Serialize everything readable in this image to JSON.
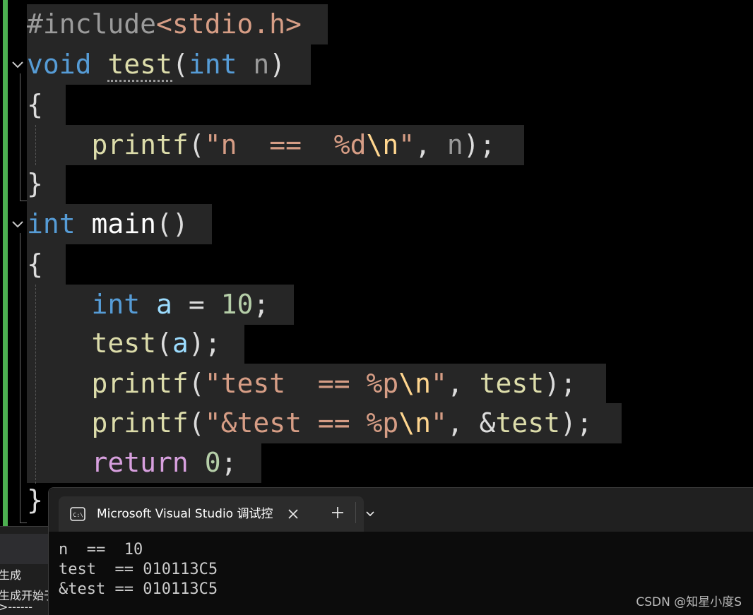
{
  "editor": {
    "lines": [
      {
        "segments": [
          [
            "#include",
            "t-pre"
          ],
          [
            "<stdio.h>",
            "t-str"
          ]
        ]
      },
      {
        "segments": [
          [
            "void",
            "t-kw"
          ],
          [
            " ",
            "t-punct"
          ],
          [
            "test",
            "t-fn squiggle"
          ],
          [
            "(",
            "t-punct"
          ],
          [
            "int",
            "t-kw"
          ],
          [
            " ",
            "t-punct"
          ],
          [
            "n",
            "t-param"
          ],
          [
            ")",
            "t-punct"
          ]
        ]
      },
      {
        "segments": [
          [
            "{",
            "t-punct"
          ]
        ]
      },
      {
        "segments": [
          [
            "    ",
            "t-punct"
          ],
          [
            "printf",
            "t-fn"
          ],
          [
            "(",
            "t-punct"
          ],
          [
            "\"n  ==  %d",
            "t-str"
          ],
          [
            "\\n",
            "t-esc"
          ],
          [
            "\"",
            "t-str"
          ],
          [
            ", ",
            "t-punct"
          ],
          [
            "n",
            "t-param"
          ],
          [
            ");",
            "t-punct"
          ]
        ]
      },
      {
        "segments": [
          [
            "}",
            "t-punct"
          ]
        ]
      },
      {
        "segments": [
          [
            "int",
            "t-kw"
          ],
          [
            " ",
            "t-punct"
          ],
          [
            "main",
            "t-white"
          ],
          [
            "()",
            "t-punct"
          ]
        ]
      },
      {
        "segments": [
          [
            "{",
            "t-punct"
          ]
        ]
      },
      {
        "segments": [
          [
            "    ",
            "t-punct"
          ],
          [
            "int",
            "t-kw"
          ],
          [
            " ",
            "t-punct"
          ],
          [
            "a",
            "t-var"
          ],
          [
            " = ",
            "t-punct"
          ],
          [
            "10",
            "t-num"
          ],
          [
            ";",
            "t-punct"
          ]
        ]
      },
      {
        "segments": [
          [
            "    ",
            "t-punct"
          ],
          [
            "test",
            "t-fn"
          ],
          [
            "(",
            "t-punct"
          ],
          [
            "a",
            "t-var"
          ],
          [
            ");",
            "t-punct"
          ]
        ]
      },
      {
        "segments": [
          [
            "    ",
            "t-punct"
          ],
          [
            "printf",
            "t-fn"
          ],
          [
            "(",
            "t-punct"
          ],
          [
            "\"test  == %p",
            "t-str"
          ],
          [
            "\\n",
            "t-esc"
          ],
          [
            "\"",
            "t-str"
          ],
          [
            ", ",
            "t-punct"
          ],
          [
            "test",
            "t-fn"
          ],
          [
            ");",
            "t-punct"
          ]
        ]
      },
      {
        "segments": [
          [
            "    ",
            "t-punct"
          ],
          [
            "printf",
            "t-fn"
          ],
          [
            "(",
            "t-punct"
          ],
          [
            "\"&test == %p",
            "t-str"
          ],
          [
            "\\n",
            "t-esc"
          ],
          [
            "\"",
            "t-str"
          ],
          [
            ", &",
            "t-punct"
          ],
          [
            "test",
            "t-fn"
          ],
          [
            ");",
            "t-punct"
          ]
        ]
      },
      {
        "segments": [
          [
            "    ",
            "t-punct"
          ],
          [
            "return",
            "t-ret"
          ],
          [
            " ",
            "t-punct"
          ],
          [
            "0",
            "t-num"
          ],
          [
            ";",
            "t-punct"
          ]
        ]
      },
      {
        "segments": [
          [
            "}",
            "t-punct"
          ]
        ]
      }
    ]
  },
  "output_panel": {
    "line1": "生成",
    "line2": "生成开始于",
    "line3": ">------"
  },
  "console": {
    "tab_title": "Microsoft Visual Studio 调试控制台",
    "new_tab_icon": "plus-icon",
    "dropdown_icon": "chevron-down-icon",
    "close_icon": "close-icon",
    "output": [
      "n  ==  10",
      "test  == 010113C5",
      "&test == 010113C5"
    ]
  },
  "watermark": "CSDN @知星小度S",
  "colors": {
    "keyword": "#569cd6",
    "function": "#dcdcaa",
    "string": "#d69d85",
    "number": "#b5cea8",
    "return_keyword": "#d8a0df",
    "change_bar": "#4caf50"
  }
}
